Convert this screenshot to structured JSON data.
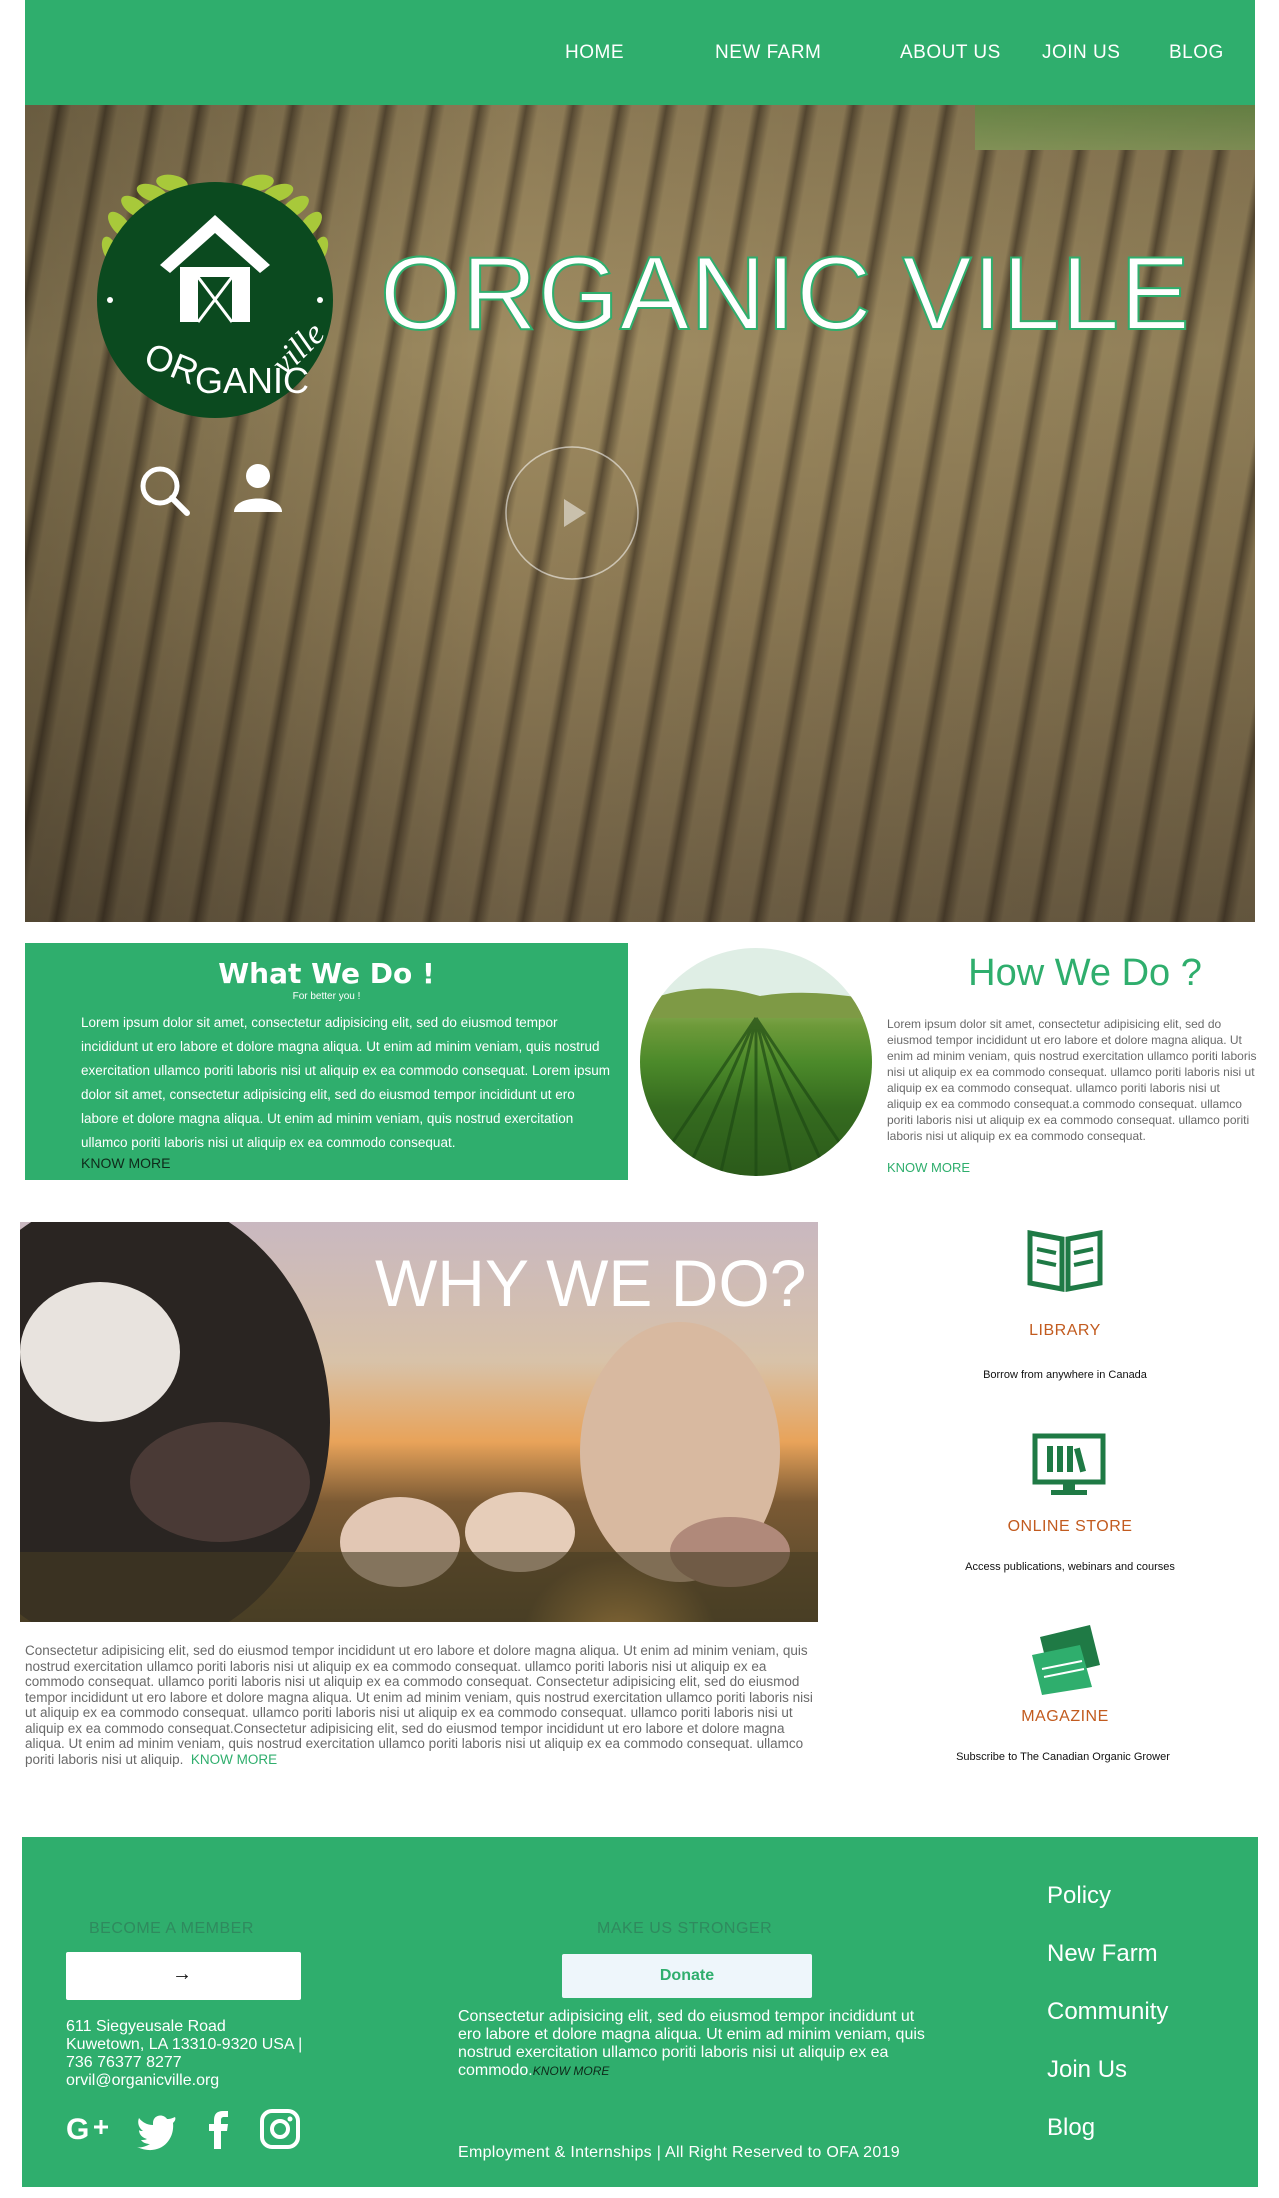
{
  "nav": {
    "items": [
      "HOME",
      "NEW FARM",
      "ABOUT US",
      "JOIN US",
      "BLOG"
    ]
  },
  "hero": {
    "title": "ORGANIC VILLE",
    "logo_text": "ORGANIC ville"
  },
  "what_we_do": {
    "title": "What We Do !",
    "subtitle": "For better you !",
    "body": "Lorem ipsum dolor sit amet, consectetur adipisicing elit, sed do eiusmod tempor incididunt ut ero labore et dolore magna aliqua. Ut enim ad minim veniam, quis nostrud exercitation ullamco poriti laboris nisi ut aliquip ex ea commodo consequat. Lorem ipsum dolor sit amet, consectetur adipisicing elit, sed do eiusmod tempor incididunt ut ero labore et dolore magna aliqua. Ut enim ad minim veniam, quis nostrud exercitation ullamco poriti laboris nisi ut aliquip ex ea commodo consequat.",
    "more": "KNOW MORE"
  },
  "how_we_do": {
    "title": "How We Do ?",
    "body": "Lorem ipsum dolor sit amet, consectetur adipisicing elit, sed do eiusmod tempor incididunt ut ero labore et dolore magna aliqua. Ut enim ad minim veniam, quis nostrud exercitation ullamco poriti laboris nisi ut aliquip ex ea commodo consequat. ullamco poriti laboris nisi ut aliquip ex ea commodo consequat. ullamco poriti laboris nisi ut aliquip ex ea commodo consequat.a commodo consequat. ullamco poriti laboris nisi ut aliquip ex ea commodo consequat. ullamco poriti laboris nisi ut aliquip ex ea commodo consequat.",
    "more": "KNOW MORE"
  },
  "why_we_do": {
    "title": "WHY WE DO?",
    "body": "Consectetur adipisicing elit, sed do eiusmod tempor incididunt ut ero labore et dolore magna aliqua. Ut enim ad minim veniam, quis nostrud exercitation ullamco poriti laboris nisi ut aliquip ex ea commodo consequat. ullamco poriti laboris nisi ut aliquip ex ea commodo consequat. ullamco poriti laboris nisi ut aliquip ex ea commodo consequat. Consectetur adipisicing elit, sed do eiusmod tempor incididunt ut ero labore et dolore magna aliqua. Ut enim ad minim veniam, quis nostrud exercitation ullamco poriti laboris nisi ut aliquip ex ea commodo consequat. ullamco poriti laboris nisi ut aliquip ex ea commodo consequat. ullamco poriti laboris nisi ut aliquip ex ea commodo consequat.Consectetur adipisicing elit, sed do eiusmod tempor incididunt ut ero labore et dolore magna aliqua. Ut enim ad minim veniam, quis nostrud exercitation ullamco poriti laboris nisi ut aliquip ex ea commodo consequat. ullamco poriti laboris nisi ut aliquip.",
    "more": "KNOW MORE"
  },
  "features": {
    "library": {
      "title": "LIBRARY",
      "desc": "Borrow from anywhere in Canada",
      "icon": "book-icon"
    },
    "store": {
      "title": "ONLINE STORE",
      "desc": "Access publications, webinars and courses",
      "icon": "monitor-icon"
    },
    "magazine": {
      "title": "MAGAZINE",
      "desc": "Subscribe to The Canadian Organic Grower",
      "icon": "magazine-icon"
    }
  },
  "footer": {
    "member_heading": "BECOME A MEMBER",
    "member_button": "→",
    "address_line1": "611 Siegyeusale Road",
    "address_line2": "Kuwetown, LA 13310-9320 USA |",
    "phone": "736 76377 8277",
    "email": "orvil@organicville.org",
    "stronger_heading": "MAKE US STRONGER",
    "donate_button": "Donate",
    "stronger_body": "Consectetur adipisicing elit, sed do eiusmod tempor incididunt ut ero labore et dolore magna aliqua. Ut enim ad minim veniam, quis nostrud exercitation ullamco poriti laboris nisi ut aliquip ex ea commodo.",
    "stronger_more": "KNOW MORE",
    "copyright": "Employment & Internships | All Right Reserved to OFA 2019",
    "links": [
      "Policy",
      "New Farm",
      "Community",
      "Join Us",
      "Blog"
    ],
    "social": [
      "google-plus-icon",
      "twitter-icon",
      "facebook-icon",
      "instagram-icon"
    ]
  },
  "colors": {
    "brand_green": "#2fae6d",
    "dark_green": "#0b4a1f",
    "accent_orange": "#c25b1f",
    "body_gray": "#6a6a6a"
  }
}
